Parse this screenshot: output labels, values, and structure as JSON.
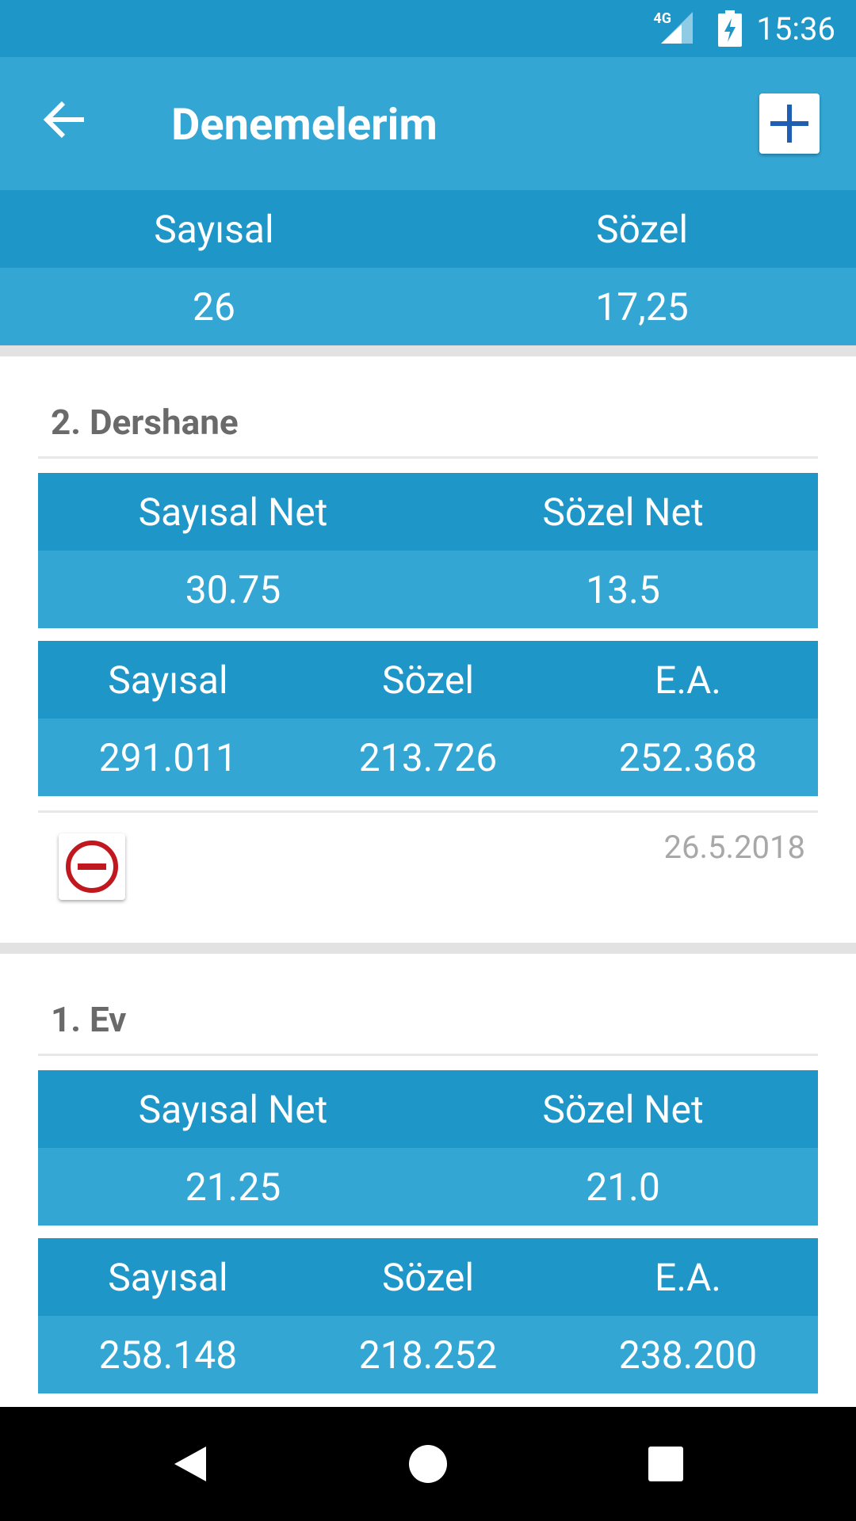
{
  "status_bar": {
    "network": "4G",
    "time": "15:36"
  },
  "toolbar": {
    "title": "Denemelerim"
  },
  "summary": {
    "headers": [
      "Sayısal",
      "Sözel"
    ],
    "values": [
      "26",
      "17,25"
    ]
  },
  "entries": [
    {
      "title": "2. Dershane",
      "net_headers": [
        "Sayısal Net",
        "Sözel Net"
      ],
      "net_values": [
        "30.75",
        "13.5"
      ],
      "score_headers": [
        "Sayısal",
        "Sözel",
        "E.A."
      ],
      "score_values": [
        "291.011",
        "213.726",
        "252.368"
      ],
      "date": "26.5.2018"
    },
    {
      "title": "1. Ev",
      "net_headers": [
        "Sayısal Net",
        "Sözel Net"
      ],
      "net_values": [
        "21.25",
        "21.0"
      ],
      "score_headers": [
        "Sayısal",
        "Sözel",
        "E.A."
      ],
      "score_values": [
        "258.148",
        "218.252",
        "238.200"
      ]
    }
  ],
  "colors": {
    "primary_dark": "#1e96c8",
    "primary": "#33a6d4",
    "remove": "#c0181e",
    "add": "#1e5fb4"
  },
  "icons": [
    "back-arrow-icon",
    "add-icon",
    "remove-circle-icon",
    "nav-back-icon",
    "nav-home-icon",
    "nav-recents-icon"
  ]
}
